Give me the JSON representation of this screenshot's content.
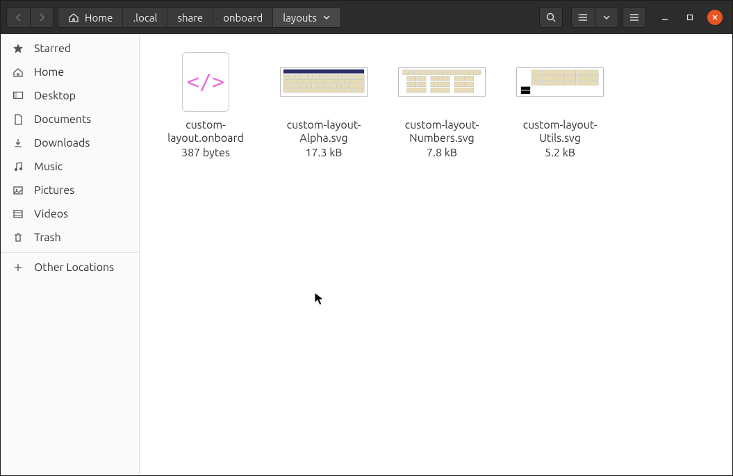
{
  "path": {
    "home_label": "Home",
    "segments": [
      ".local",
      "share",
      "onboard",
      "layouts"
    ]
  },
  "sidebar": {
    "items": [
      {
        "icon": "star",
        "label": "Starred"
      },
      {
        "icon": "home",
        "label": "Home"
      },
      {
        "icon": "desktop",
        "label": "Desktop"
      },
      {
        "icon": "documents",
        "label": "Documents"
      },
      {
        "icon": "downloads",
        "label": "Downloads"
      },
      {
        "icon": "music",
        "label": "Music"
      },
      {
        "icon": "pictures",
        "label": "Pictures"
      },
      {
        "icon": "videos",
        "label": "Videos"
      },
      {
        "icon": "trash",
        "label": "Trash"
      }
    ],
    "other": {
      "icon": "plus",
      "label": "Other Locations"
    }
  },
  "files": [
    {
      "type": "code",
      "name": "custom-layout.onboard",
      "size": "387 bytes"
    },
    {
      "type": "kb-alpha",
      "name": "custom-layout-Alpha.svg",
      "size": "17.3 kB"
    },
    {
      "type": "kb-num",
      "name": "custom-layout-Numbers.svg",
      "size": "7.8 kB"
    },
    {
      "type": "kb-utils",
      "name": "custom-layout-Utils.svg",
      "size": "5.2 kB"
    }
  ]
}
